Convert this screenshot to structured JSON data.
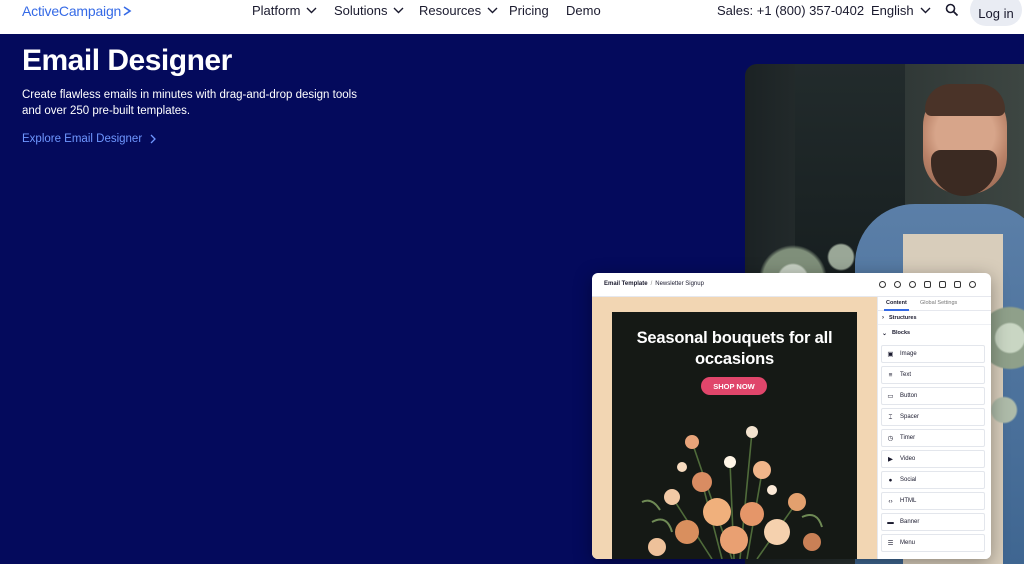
{
  "nav": {
    "logo": "ActiveCampaign",
    "items": [
      {
        "label": "Platform",
        "dropdown": true
      },
      {
        "label": "Solutions",
        "dropdown": true
      },
      {
        "label": "Resources",
        "dropdown": true
      },
      {
        "label": "Pricing",
        "dropdown": false
      },
      {
        "label": "Demo",
        "dropdown": false
      }
    ],
    "sales": "Sales: +1 (800) 357-0402",
    "language": "English",
    "login": "Log in",
    "search_icon": "search-icon"
  },
  "hero": {
    "title": "Email Designer",
    "description": "Create flawless emails in minutes with drag-and-drop design tools and over 250 pre-built templates.",
    "link": "Explore Email Designer"
  },
  "editor": {
    "breadcrumb_root": "Email Template",
    "breadcrumb_sep": "/",
    "breadcrumb_page": "Newsletter Signup",
    "email_title": "Seasonal bouquets for all occasions",
    "shop_button": "SHOP NOW",
    "panel": {
      "tabs": [
        "Content",
        "Global Settings"
      ],
      "structures": "Structures",
      "blocks_header": "Blocks",
      "blocks": [
        "Image",
        "Text",
        "Button",
        "Spacer",
        "Timer",
        "Video",
        "Social",
        "HTML",
        "Banner",
        "Menu"
      ]
    }
  },
  "colors": {
    "hero_bg": "#040a5c",
    "accent": "#356ae6",
    "link": "#6f97ff",
    "shop_button": "#e0466b",
    "canvas_bg": "#f2d6b3"
  }
}
